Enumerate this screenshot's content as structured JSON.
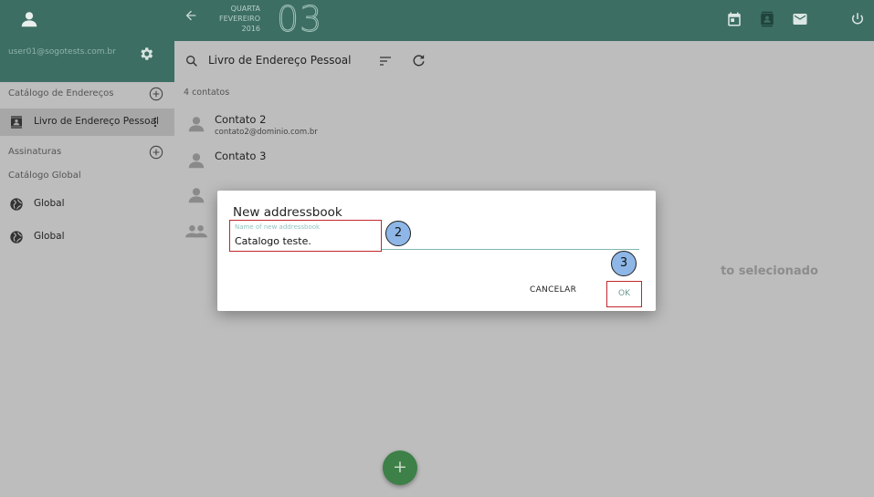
{
  "sidebar": {
    "user_email": "user01@sogotests.com.br",
    "sections": {
      "catalog": "Catálogo de Endereços",
      "subscriptions": "Assinaturas",
      "global": "Catálogo Global"
    },
    "items": [
      {
        "label": "Livro de Endereço Pessoal",
        "icon": "contacts-book-icon",
        "selected": true
      },
      {
        "label": "Global",
        "icon": "globe-icon"
      },
      {
        "label": "Global",
        "icon": "globe-icon"
      }
    ]
  },
  "topbar": {
    "weekday": "QUARTA",
    "month": "FEVEREIRO",
    "year": "2016",
    "day": "03",
    "icons": [
      "calendar-icon",
      "contacts-icon",
      "mail-icon",
      "power-icon"
    ]
  },
  "contacts": {
    "addressbook_title": "Livro de Endereço Pessoal",
    "count": "4 contatos",
    "list": [
      {
        "name": "Contato 2",
        "email": "contato2@dominio.com.br",
        "icon": "person-icon"
      },
      {
        "name": "Contato 3",
        "email": "",
        "icon": "person-icon"
      },
      {
        "name": "",
        "email": "",
        "icon": "person-icon"
      },
      {
        "name": "",
        "email": "",
        "icon": "group-icon"
      }
    ],
    "fab_label": "+"
  },
  "detail": {
    "empty_text": "to selecionado"
  },
  "dialog": {
    "title": "New addressbook",
    "field_label": "Name of new addressbook",
    "field_value": "Catalogo teste.",
    "cancel_label": "CANCELAR",
    "ok_label": "OK"
  },
  "callouts": [
    "2",
    "3"
  ],
  "colors": {
    "header": "#3d6e63",
    "panel": "#bdbdbd",
    "fab": "#3d8048",
    "highlight": "#c1272d",
    "callout": "#8eb7e8"
  }
}
